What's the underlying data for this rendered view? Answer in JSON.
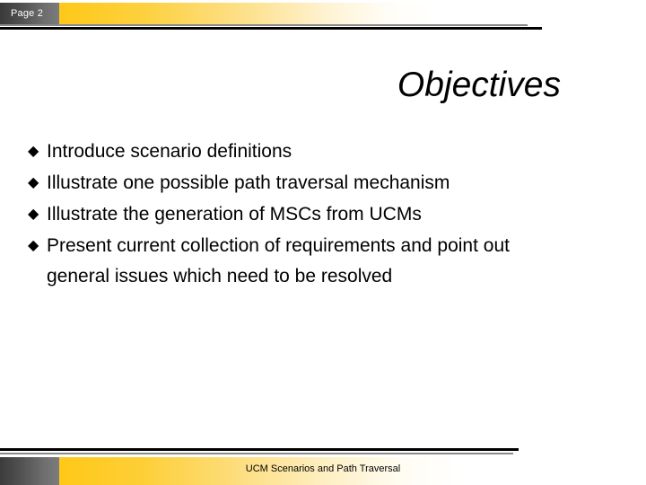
{
  "slide": {
    "page_label": "Page 2",
    "title": "Objectives",
    "bullet_marker": "◆",
    "bullets": [
      {
        "text": "Introduce scenario definitions"
      },
      {
        "text": "Illustrate one possible path traversal mechanism"
      },
      {
        "text": "Illustrate the generation of MSCs from UCMs"
      },
      {
        "text": "Present current collection of requirements and point out general issues which need to be resolved"
      }
    ],
    "footer_text": "UCM Scenarios and Path Traversal"
  },
  "colors": {
    "accent_yellow": "#ffc819",
    "tab_gray_dark": "#3a3a3a",
    "tab_gray_light": "#7b7b7b",
    "rule_black": "#000000",
    "rule_gray": "#888888",
    "text": "#000000",
    "page_label_text": "#ffffff",
    "background": "#ffffff"
  }
}
